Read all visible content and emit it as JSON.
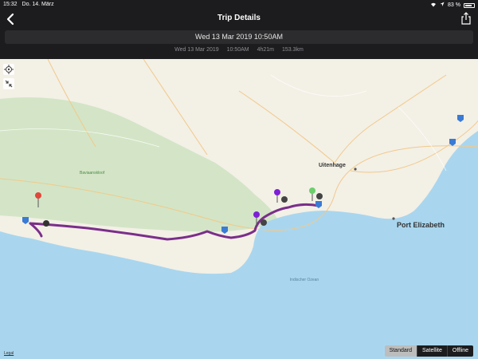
{
  "status": {
    "time": "15:32",
    "date": "Do. 14. März",
    "battery": "83 %",
    "battery_level": 0.83
  },
  "nav": {
    "title": "Trip Details"
  },
  "trip": {
    "header_datetime": "Wed 13 Mar 2019 10:50AM",
    "date": "Wed 13 Mar 2019",
    "start_time": "10:50AM",
    "duration": "4h21m",
    "distance": "153.3km"
  },
  "map": {
    "cities": {
      "uitenhage": "Uitenhage",
      "port_elizabeth": "Port Elizabeth"
    },
    "park": "Baviaanskloof",
    "ocean": "Indischer Ozean",
    "legal": "Legal",
    "route_color": "#7a2e8a",
    "modes": [
      "Standard",
      "Satellite",
      "Offline"
    ],
    "selected_mode": "Standard"
  }
}
